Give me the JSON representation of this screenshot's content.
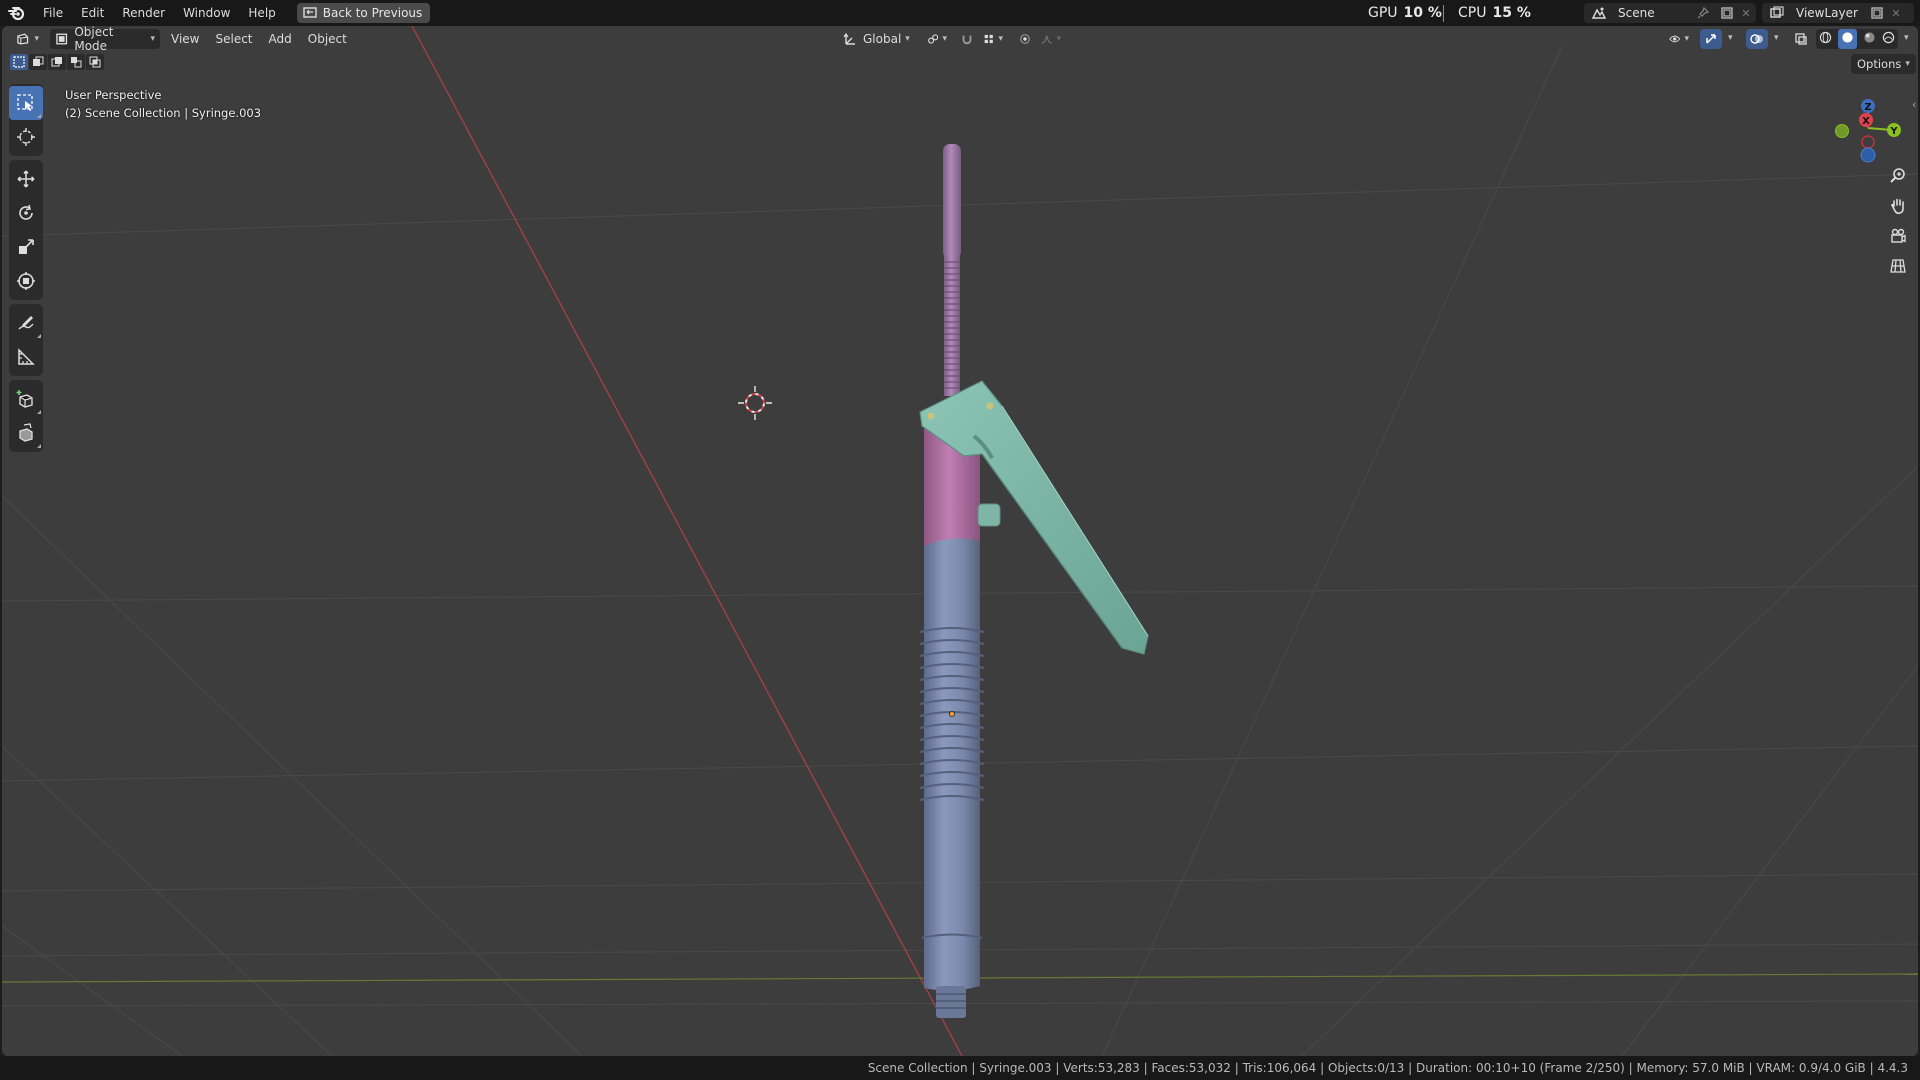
{
  "menu": {
    "items": [
      {
        "name": "menu-file",
        "label": "File"
      },
      {
        "name": "menu-edit",
        "label": "Edit"
      },
      {
        "name": "menu-render",
        "label": "Render"
      },
      {
        "name": "menu-window",
        "label": "Window"
      },
      {
        "name": "menu-help",
        "label": "Help"
      }
    ],
    "back_label": "Back to Previous"
  },
  "stats": {
    "gpu_label": "GPU",
    "gpu_value": "10 %",
    "cpu_label": "CPU",
    "cpu_value": "15 %"
  },
  "scene": {
    "name": "Scene",
    "view_layer": "ViewLayer"
  },
  "viewport_header": {
    "mode": "Object Mode",
    "menus": [
      "View",
      "Select",
      "Add",
      "Object"
    ],
    "orientation": "Global",
    "options_label": "Options"
  },
  "viewport_info": {
    "perspective": "User Perspective",
    "collection": "(2) Scene Collection | Syringe.003"
  },
  "gizmo": {
    "x": "X",
    "y": "Y",
    "z": "Z"
  },
  "status": {
    "text": "Scene Collection | Syringe.003 | Verts:53,283 | Faces:53,032 | Tris:106,064 | Objects:0/13 | Duration: 00:10+10 (Frame 2/250) | Memory: 57.0 MiB | VRAM: 0.9/4.0 GiB | 4.4.3"
  },
  "colors": {
    "background": "#3d3d3d",
    "accent": "#4772b3",
    "plunger": "#9e7aa6",
    "barrel": "#7c8aad",
    "handle": "#7fb5a7",
    "collar": "#a86b9c",
    "x_axis": "#c0424b",
    "y_axis": "#7a9a2c"
  }
}
